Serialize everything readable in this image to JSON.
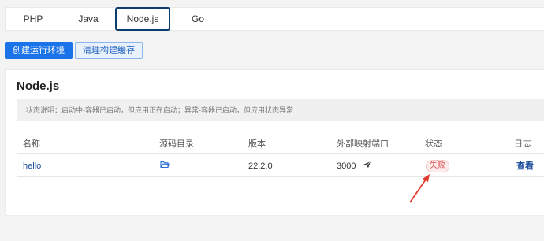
{
  "tabs": [
    {
      "label": "PHP",
      "active": false
    },
    {
      "label": "Java",
      "active": false
    },
    {
      "label": "Node.js",
      "active": true
    },
    {
      "label": "Go",
      "active": false
    }
  ],
  "toolbar": {
    "create_label": "创建运行环境",
    "clear_cache_label": "清理构建缓存"
  },
  "card": {
    "title": "Node.js",
    "status_notice": "状态说明：启动中-容器已启动，但应用正在启动；异常-容器已启动，但应用状态异常"
  },
  "table": {
    "headers": [
      "名称",
      "源码目录",
      "版本",
      "外部映射端口",
      "状态",
      "日志"
    ],
    "rows": [
      {
        "name": "hello",
        "source_dir_icon": "folder-open-icon",
        "version": "22.2.0",
        "port": "3000",
        "port_icon": "send-icon",
        "status": "失败",
        "log_action": "查看"
      }
    ]
  },
  "colors": {
    "primary": "#1a73e8",
    "link": "#1a4c9c",
    "error": "#d9534f",
    "annotation_arrow": "#e03a2f"
  }
}
